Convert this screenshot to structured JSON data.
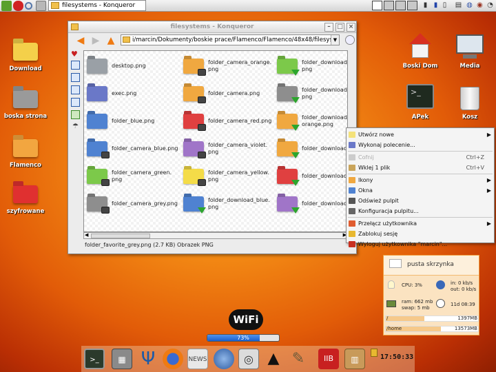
{
  "topbar": {
    "task_title": "filesystems - Konqueror"
  },
  "desktop": {
    "icons_left": [
      {
        "label": "Download"
      },
      {
        "label": "boska strona"
      },
      {
        "label": "Flamenco"
      },
      {
        "label": "szyfrowane"
      }
    ],
    "icons_right": [
      {
        "label": "Boski Dom"
      },
      {
        "label": "Media"
      },
      {
        "label": "APek"
      },
      {
        "label": "Kosz"
      }
    ]
  },
  "konqueror": {
    "title": "filesystems - Konqueror",
    "url": "i/marcin/Dokumenty/boskie prace/Flamenco/Flamenco/48x48/filesystems",
    "files": [
      {
        "name": "desktop.png",
        "color": "#9aa0a6",
        "emblem": ""
      },
      {
        "name": "folder_camera_orange.\npng",
        "color": "#f0a840",
        "emblem": "cam"
      },
      {
        "name": "folder_download_green.\npng",
        "color": "#7cc94a",
        "emblem": "dl"
      },
      {
        "name": "exec.png",
        "color": "#6a78c8",
        "emblem": ""
      },
      {
        "name": "folder_camera.png",
        "color": "#f0a840",
        "emblem": "cam"
      },
      {
        "name": "folder_download_grey.\npng",
        "color": "#8e8e8e",
        "emblem": "dl"
      },
      {
        "name": "folder_blue.png",
        "color": "#4f82d1",
        "emblem": ""
      },
      {
        "name": "folder_camera_red.png",
        "color": "#e04040",
        "emblem": "cam"
      },
      {
        "name": "folder_download_\norange.png",
        "color": "#f0a840",
        "emblem": "dl"
      },
      {
        "name": "folder_camera_blue.png",
        "color": "#4f82d1",
        "emblem": "cam"
      },
      {
        "name": "folder_camera_violet.\npng",
        "color": "#a075c8",
        "emblem": "cam"
      },
      {
        "name": "folder_download",
        "color": "#f0a840",
        "emblem": "dl"
      },
      {
        "name": "folder_camera_green.\npng",
        "color": "#7cc94a",
        "emblem": "cam"
      },
      {
        "name": "folder_camera_yellow.\npng",
        "color": "#f4dc48",
        "emblem": "cam"
      },
      {
        "name": "folder_download",
        "color": "#e04040",
        "emblem": "dl"
      },
      {
        "name": "folder_camera_grey.png",
        "color": "#8e8e8e",
        "emblem": "cam"
      },
      {
        "name": "folder_download_blue.\npng",
        "color": "#4f82d1",
        "emblem": "dl"
      },
      {
        "name": "folder_download",
        "color": "#a075c8",
        "emblem": "dl"
      }
    ],
    "status": "folder_favorite_grey.png (2.7 KB)  Obrazek PNG"
  },
  "context_menu": {
    "items": [
      {
        "label": "Utwórz nowe",
        "shortcut": "",
        "submenu": true,
        "disabled": false,
        "icon_color": "#f4e27a"
      },
      {
        "label": "Wykonaj polecenie...",
        "shortcut": "",
        "submenu": false,
        "disabled": false,
        "icon_color": "#6a78c8"
      },
      {
        "label": "Cofnij",
        "shortcut": "Ctrl+Z",
        "submenu": false,
        "disabled": true,
        "icon_color": "#cccccc"
      },
      {
        "label": "Wklej 1 plik",
        "shortcut": "Ctrl+V",
        "submenu": false,
        "disabled": false,
        "icon_color": "#c9a45a"
      },
      {
        "label": "Ikony",
        "shortcut": "",
        "submenu": true,
        "disabled": false,
        "icon_color": "#f0a840"
      },
      {
        "label": "Okna",
        "shortcut": "",
        "submenu": true,
        "disabled": false,
        "icon_color": "#4f82d1"
      },
      {
        "label": "Odśwież pulpit",
        "shortcut": "",
        "submenu": false,
        "disabled": false,
        "icon_color": "#555555"
      },
      {
        "label": "Konfiguracja pulpitu...",
        "shortcut": "",
        "submenu": false,
        "disabled": false,
        "icon_color": "#666666"
      },
      {
        "label": "Przełącz użytkownika",
        "shortcut": "",
        "submenu": true,
        "disabled": false,
        "icon_color": "#e05c30"
      },
      {
        "label": "Zablokuj sesję",
        "shortcut": "",
        "submenu": false,
        "disabled": false,
        "icon_color": "#e8b830"
      },
      {
        "label": "Wyloguj użytkownika \"marcin\"...",
        "shortcut": "",
        "submenu": false,
        "disabled": false,
        "icon_color": "#c83020"
      }
    ]
  },
  "monitor": {
    "mail": "pusta skrzynka",
    "cpu": "CPU: 3%",
    "net_in": "in:  0 kb/s",
    "net_out": "out: 0 kb/s",
    "ram": "ram: 662 mb",
    "swap": "swap: 5 mb",
    "uptime": "11d 08:39",
    "disks": [
      {
        "mount": "/",
        "size": "1397MB",
        "used_fraction": 0.42
      },
      {
        "mount": "/home",
        "size": "13573MB",
        "used_fraction": 0.6
      }
    ]
  },
  "wifi": {
    "label": "WiFi",
    "signal_text": "73%",
    "signal_fraction": 0.73
  },
  "clock": "17:50:33"
}
